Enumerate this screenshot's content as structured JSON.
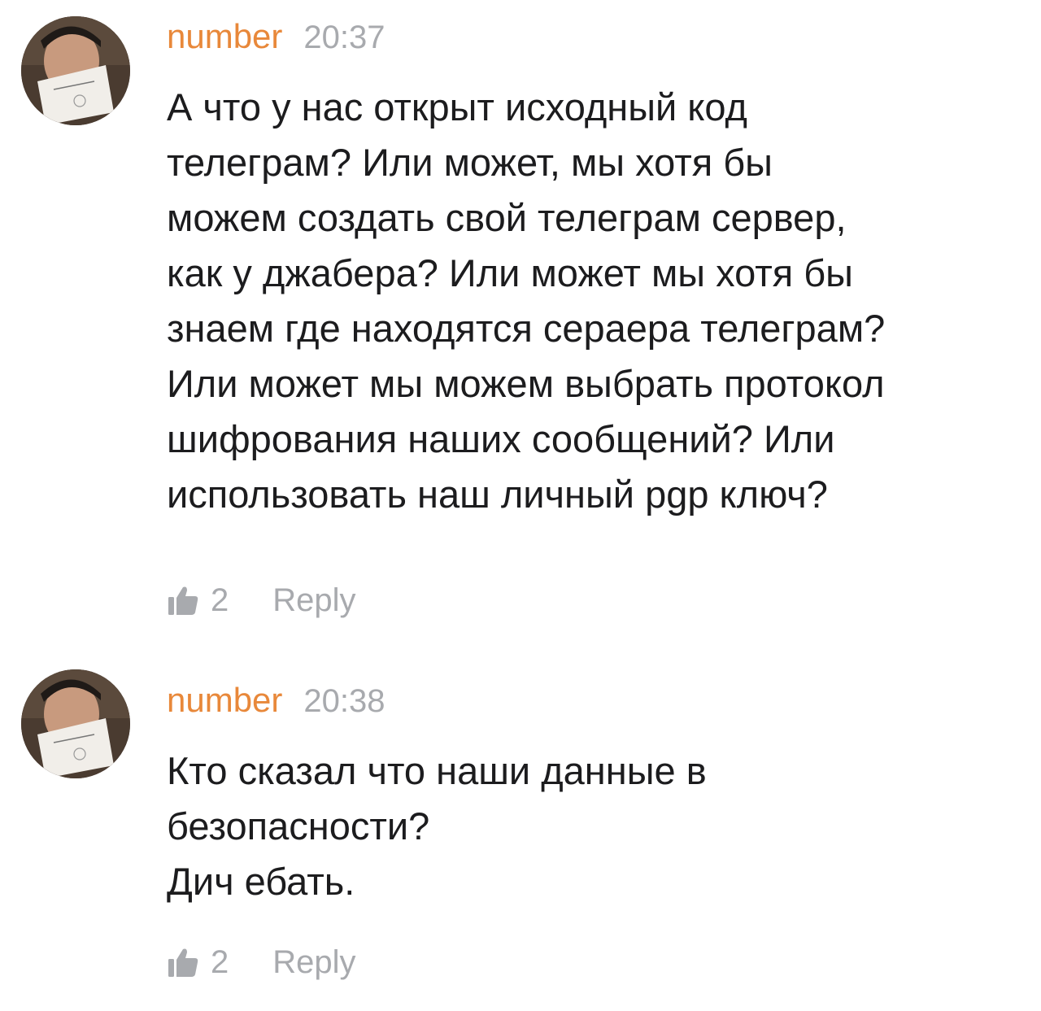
{
  "comments": [
    {
      "author": "number",
      "time": "20:37",
      "lines": [
        "А что у нас открыт исходный код",
        "телеграм? Или может, мы хотя бы",
        "можем создать свой телеграм сервер,",
        "как у джабера? Или может мы хотя бы",
        "знаем где находятся сераера телеграм?",
        "Или может мы можем выбрать протокол",
        "шифрования наших сообщений? Или",
        "использовать наш личный pgp ключ?"
      ],
      "likes": "2",
      "reply_label": "Reply",
      "like_icon": "thumbs-up-icon"
    },
    {
      "author": "number",
      "time": "20:38",
      "lines": [
        "Кто сказал что наши данные в",
        "безопасности?",
        "Дич ебать."
      ],
      "likes": "2",
      "reply_label": "Reply",
      "like_icon": "thumbs-up-icon"
    }
  ],
  "colors": {
    "author": "#e8883a",
    "meta": "#a8aaae",
    "text": "#1c1c1e"
  }
}
